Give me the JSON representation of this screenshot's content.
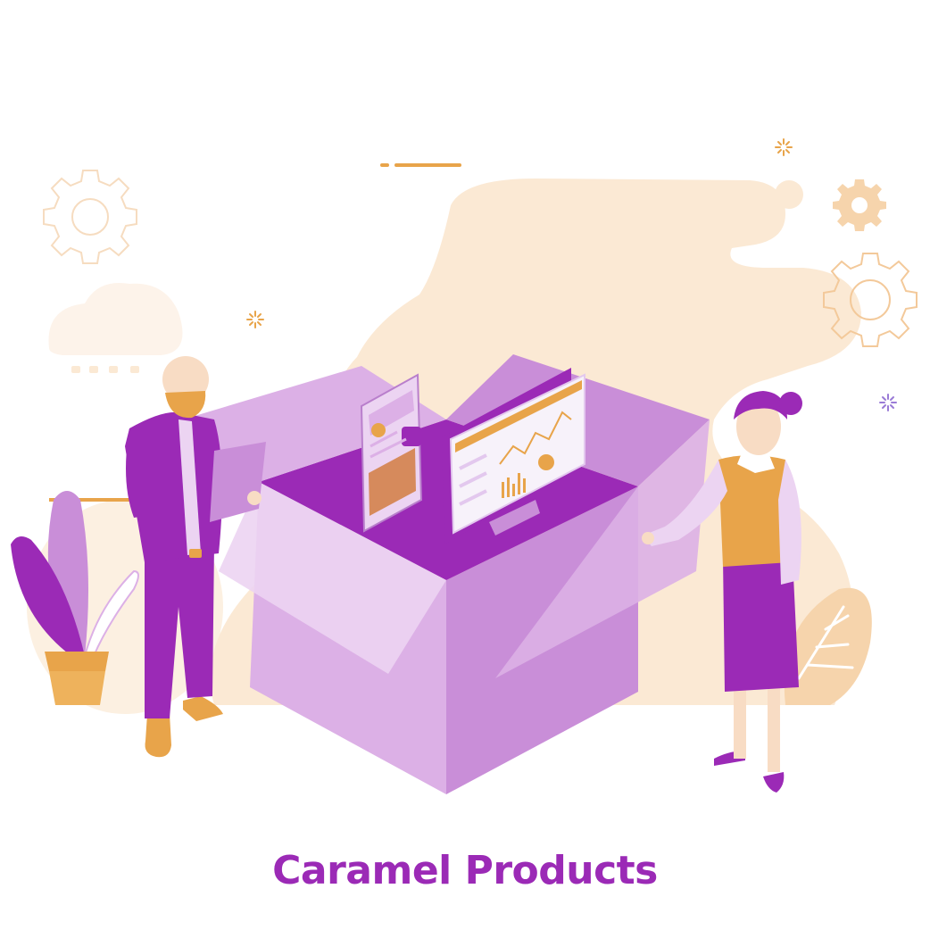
{
  "caption": {
    "text": "Caramel Products"
  },
  "colors": {
    "purple_dark": "#9b2ab6",
    "purple_mid": "#c98ed8",
    "purple_light": "#dcb0e6",
    "purple_pale": "#ecd4f2",
    "cream": "#fbe9d4",
    "orange": "#e8a44a",
    "skin": "#f8dcc4",
    "caption": "#9b2ab6"
  },
  "icons": [
    "gear-icon",
    "cloud-icon",
    "sparkle-icon",
    "plant-icon",
    "line-chart-icon",
    "bar-chart-icon",
    "pie-chart-icon",
    "user-icon"
  ]
}
